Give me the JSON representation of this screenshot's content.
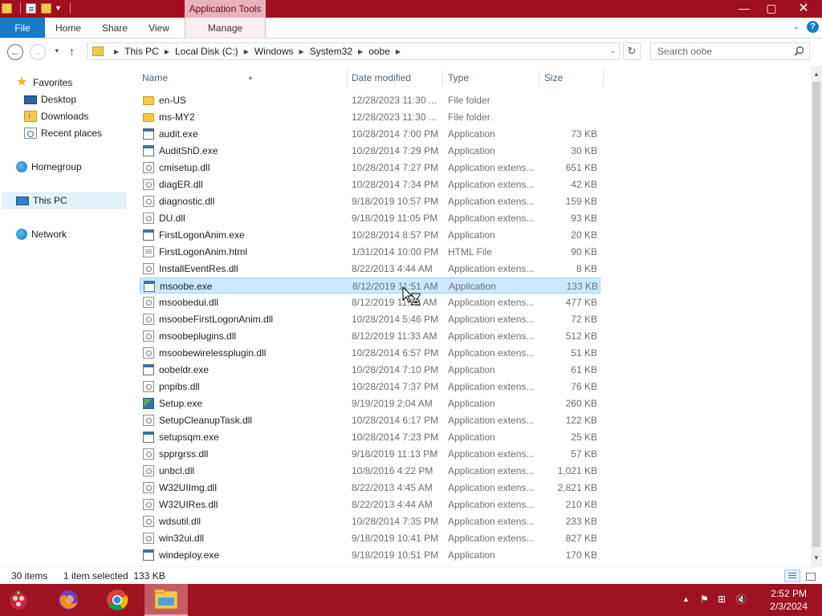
{
  "titlebar": {
    "contextual_tab": "Application Tools",
    "minimize": "—",
    "maximize": "▢",
    "close": "✕"
  },
  "ribbon": {
    "tabs": [
      "File",
      "Home",
      "Share",
      "View",
      "Manage"
    ],
    "help": "?"
  },
  "address": {
    "crumbs": [
      "This PC",
      "Local Disk (C:)",
      "Windows",
      "System32",
      "oobe"
    ]
  },
  "search": {
    "placeholder": "Search oobe"
  },
  "navpane": {
    "favorites": "Favorites",
    "desktop": "Desktop",
    "downloads": "Downloads",
    "recent": "Recent places",
    "homegroup": "Homegroup",
    "thispc": "This PC",
    "network": "Network"
  },
  "columns": {
    "name": "Name",
    "date": "Date modified",
    "type": "Type",
    "size": "Size"
  },
  "files": [
    {
      "name": "en-US",
      "date": "12/28/2023 11:30 ...",
      "type": "File folder",
      "size": "",
      "icon": "folder-icon"
    },
    {
      "name": "ms-MY2",
      "date": "12/28/2023 11:30 ...",
      "type": "File folder",
      "size": "",
      "icon": "folder-icon"
    },
    {
      "name": "audit.exe",
      "date": "10/28/2014 7:00 PM",
      "type": "Application",
      "size": "73 KB",
      "icon": "app-icon"
    },
    {
      "name": "AuditShD.exe",
      "date": "10/28/2014 7:29 PM",
      "type": "Application",
      "size": "30 KB",
      "icon": "app-icon"
    },
    {
      "name": "cmisetup.dll",
      "date": "10/28/2014 7:27 PM",
      "type": "Application extens...",
      "size": "651 KB",
      "icon": "dll-icon"
    },
    {
      "name": "diagER.dll",
      "date": "10/28/2014 7:34 PM",
      "type": "Application extens...",
      "size": "42 KB",
      "icon": "dll-icon"
    },
    {
      "name": "diagnostic.dll",
      "date": "9/18/2019 10:57 PM",
      "type": "Application extens...",
      "size": "159 KB",
      "icon": "dll-icon"
    },
    {
      "name": "DU.dll",
      "date": "9/18/2019 11:05 PM",
      "type": "Application extens...",
      "size": "93 KB",
      "icon": "dll-icon"
    },
    {
      "name": "FirstLogonAnim.exe",
      "date": "10/28/2014 8:57 PM",
      "type": "Application",
      "size": "20 KB",
      "icon": "app-icon"
    },
    {
      "name": "FirstLogonAnim.html",
      "date": "1/31/2014 10:00 PM",
      "type": "HTML File",
      "size": "90 KB",
      "icon": "html-file-icon"
    },
    {
      "name": "InstallEventRes.dll",
      "date": "8/22/2013 4:44 AM",
      "type": "Application extens...",
      "size": "8 KB",
      "icon": "dll-icon"
    },
    {
      "name": "msoobe.exe",
      "date": "8/12/2019 11:51 AM",
      "type": "Application",
      "size": "133 KB",
      "icon": "app-icon",
      "selected": true
    },
    {
      "name": "msoobedui.dll",
      "date": "8/12/2019 11:52 AM",
      "type": "Application extens...",
      "size": "477 KB",
      "icon": "dll-icon"
    },
    {
      "name": "msoobeFirstLogonAnim.dll",
      "date": "10/28/2014 5:46 PM",
      "type": "Application extens...",
      "size": "72 KB",
      "icon": "dll-icon"
    },
    {
      "name": "msoobeplugins.dll",
      "date": "8/12/2019 11:33 AM",
      "type": "Application extens...",
      "size": "512 KB",
      "icon": "dll-icon"
    },
    {
      "name": "msoobewirelessplugin.dll",
      "date": "10/28/2014 6:57 PM",
      "type": "Application extens...",
      "size": "51 KB",
      "icon": "dll-icon"
    },
    {
      "name": "oobeldr.exe",
      "date": "10/28/2014 7:10 PM",
      "type": "Application",
      "size": "61 KB",
      "icon": "app-icon"
    },
    {
      "name": "pnpibs.dll",
      "date": "10/28/2014 7:37 PM",
      "type": "Application extens...",
      "size": "76 KB",
      "icon": "dll-icon"
    },
    {
      "name": "Setup.exe",
      "date": "9/19/2019 2:04 AM",
      "type": "Application",
      "size": "260 KB",
      "icon": "setup-icon"
    },
    {
      "name": "SetupCleanupTask.dll",
      "date": "10/28/2014 6:17 PM",
      "type": "Application extens...",
      "size": "122 KB",
      "icon": "dll-icon"
    },
    {
      "name": "setupsqm.exe",
      "date": "10/28/2014 7:23 PM",
      "type": "Application",
      "size": "25 KB",
      "icon": "app-icon"
    },
    {
      "name": "spprgrss.dll",
      "date": "9/18/2019 11:13 PM",
      "type": "Application extens...",
      "size": "57 KB",
      "icon": "dll-icon"
    },
    {
      "name": "unbcl.dll",
      "date": "10/8/2016 4:22 PM",
      "type": "Application extens...",
      "size": "1,021 KB",
      "icon": "dll-icon"
    },
    {
      "name": "W32UIImg.dll",
      "date": "8/22/2013 4:45 AM",
      "type": "Application extens...",
      "size": "2,821 KB",
      "icon": "dll-icon"
    },
    {
      "name": "W32UIRes.dll",
      "date": "8/22/2013 4:44 AM",
      "type": "Application extens...",
      "size": "210 KB",
      "icon": "dll-icon"
    },
    {
      "name": "wdsutil.dll",
      "date": "10/28/2014 7:35 PM",
      "type": "Application extens...",
      "size": "233 KB",
      "icon": "dll-icon"
    },
    {
      "name": "win32ui.dll",
      "date": "9/18/2019 10:41 PM",
      "type": "Application extens...",
      "size": "827 KB",
      "icon": "dll-icon"
    },
    {
      "name": "windeploy.exe",
      "date": "9/18/2019 10:51 PM",
      "type": "Application",
      "size": "170 KB",
      "icon": "app-icon"
    }
  ],
  "status": {
    "items": "30 items",
    "selection": "1 item selected  133 KB"
  },
  "taskbar": {
    "time": "2:52 PM",
    "date": "2/3/2024"
  },
  "colors": {
    "title_bar": "#a10f1e",
    "taskbar": "#9e1221",
    "file_tab": "#1979ca",
    "selection": "#cce8ff"
  }
}
